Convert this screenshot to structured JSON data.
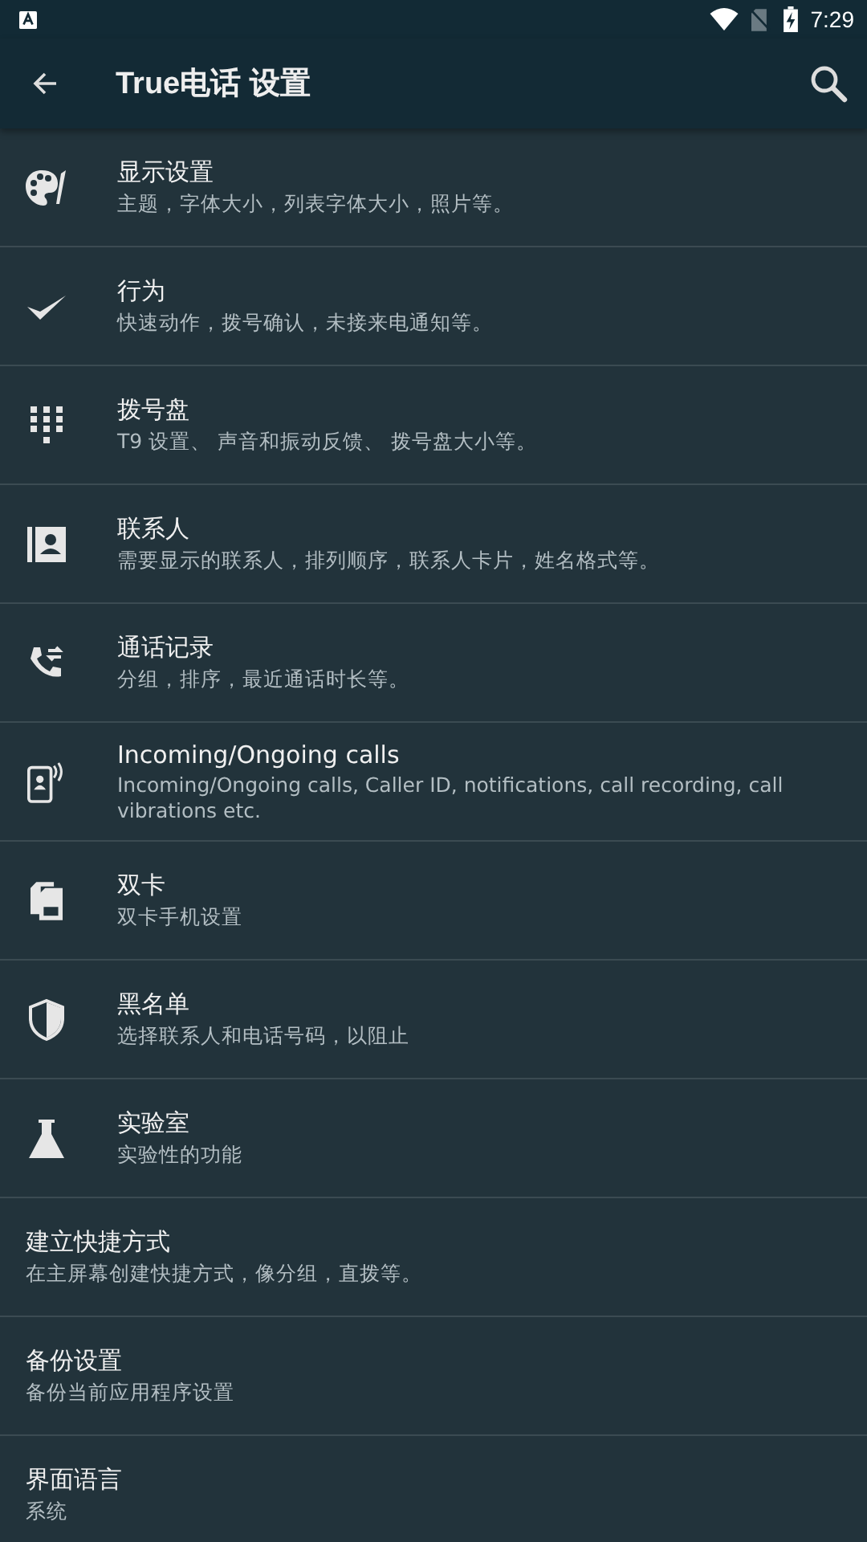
{
  "status_bar": {
    "time": "7:29"
  },
  "toolbar": {
    "title": "True电话 设置"
  },
  "items": [
    {
      "kind": "icon",
      "title": "显示设置",
      "subtitle": "主题，字体大小，列表字体大小，照片等。"
    },
    {
      "kind": "icon",
      "title": "行为",
      "subtitle": "快速动作，拨号确认，未接来电通知等。"
    },
    {
      "kind": "icon",
      "title": "拨号盘",
      "subtitle": "T9 设置、 声音和振动反馈、 拨号盘大小等。"
    },
    {
      "kind": "icon",
      "title": "联系人",
      "subtitle": "需要显示的联系人，排列顺序，联系人卡片，姓名格式等。"
    },
    {
      "kind": "icon",
      "title": "通话记录",
      "subtitle": "分组，排序，最近通话时长等。"
    },
    {
      "kind": "icon",
      "title": "Incoming/Ongoing calls",
      "subtitle": "Incoming/Ongoing calls, Caller ID, notifications, call recording, call vibrations etc."
    },
    {
      "kind": "icon",
      "title": "双卡",
      "subtitle": "双卡手机设置"
    },
    {
      "kind": "icon",
      "title": "黑名单",
      "subtitle": "选择联系人和电话号码，以阻止"
    },
    {
      "kind": "icon",
      "title": "实验室",
      "subtitle": "实验性的功能"
    },
    {
      "kind": "text",
      "title": "建立快捷方式",
      "subtitle": "在主屏幕创建快捷方式，像分组，直拨等。"
    },
    {
      "kind": "text",
      "title": "备份设置",
      "subtitle": "备份当前应用程序设置"
    },
    {
      "kind": "text",
      "title": "界面语言",
      "subtitle": "系统"
    }
  ]
}
